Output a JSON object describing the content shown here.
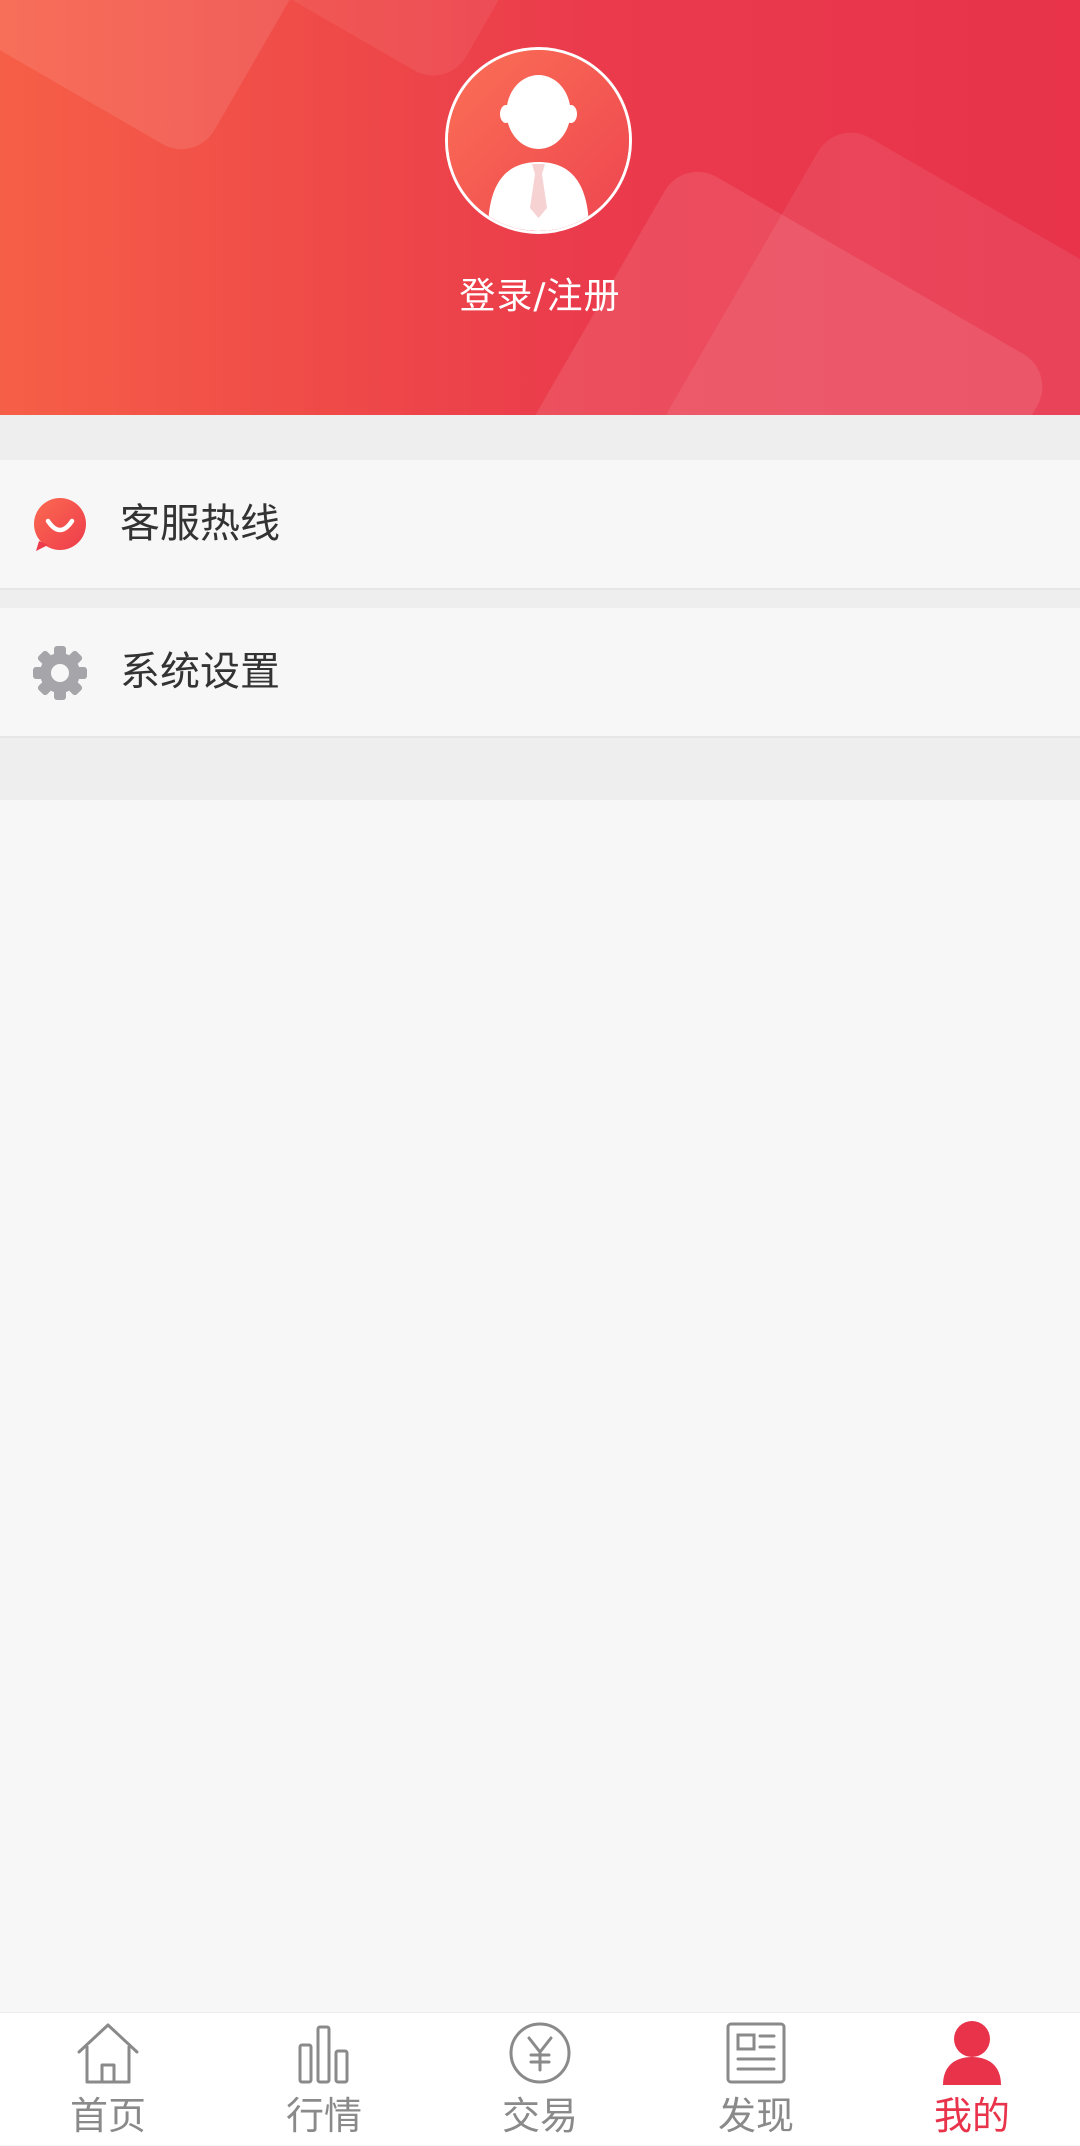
{
  "header": {
    "login_label": "登录/注册"
  },
  "menu": [
    {
      "label": "客服热线",
      "icon": "customer-service-icon",
      "icon_color": "#f0424b"
    },
    {
      "label": "系统设置",
      "icon": "gear-icon",
      "icon_color": "#a5a5aa"
    }
  ],
  "tabs": [
    {
      "label": "首页",
      "icon": "home-icon",
      "active": false
    },
    {
      "label": "行情",
      "icon": "bar-chart-icon",
      "active": false
    },
    {
      "label": "交易",
      "icon": "yen-coin-icon",
      "active": false
    },
    {
      "label": "发现",
      "icon": "news-icon",
      "active": false
    },
    {
      "label": "我的",
      "icon": "user-icon",
      "active": true
    }
  ],
  "colors": {
    "accent": "#e8334b",
    "header_gradient_start": "#f65f47",
    "header_gradient_end": "#e8334b",
    "tab_inactive": "#8a8a8a"
  }
}
